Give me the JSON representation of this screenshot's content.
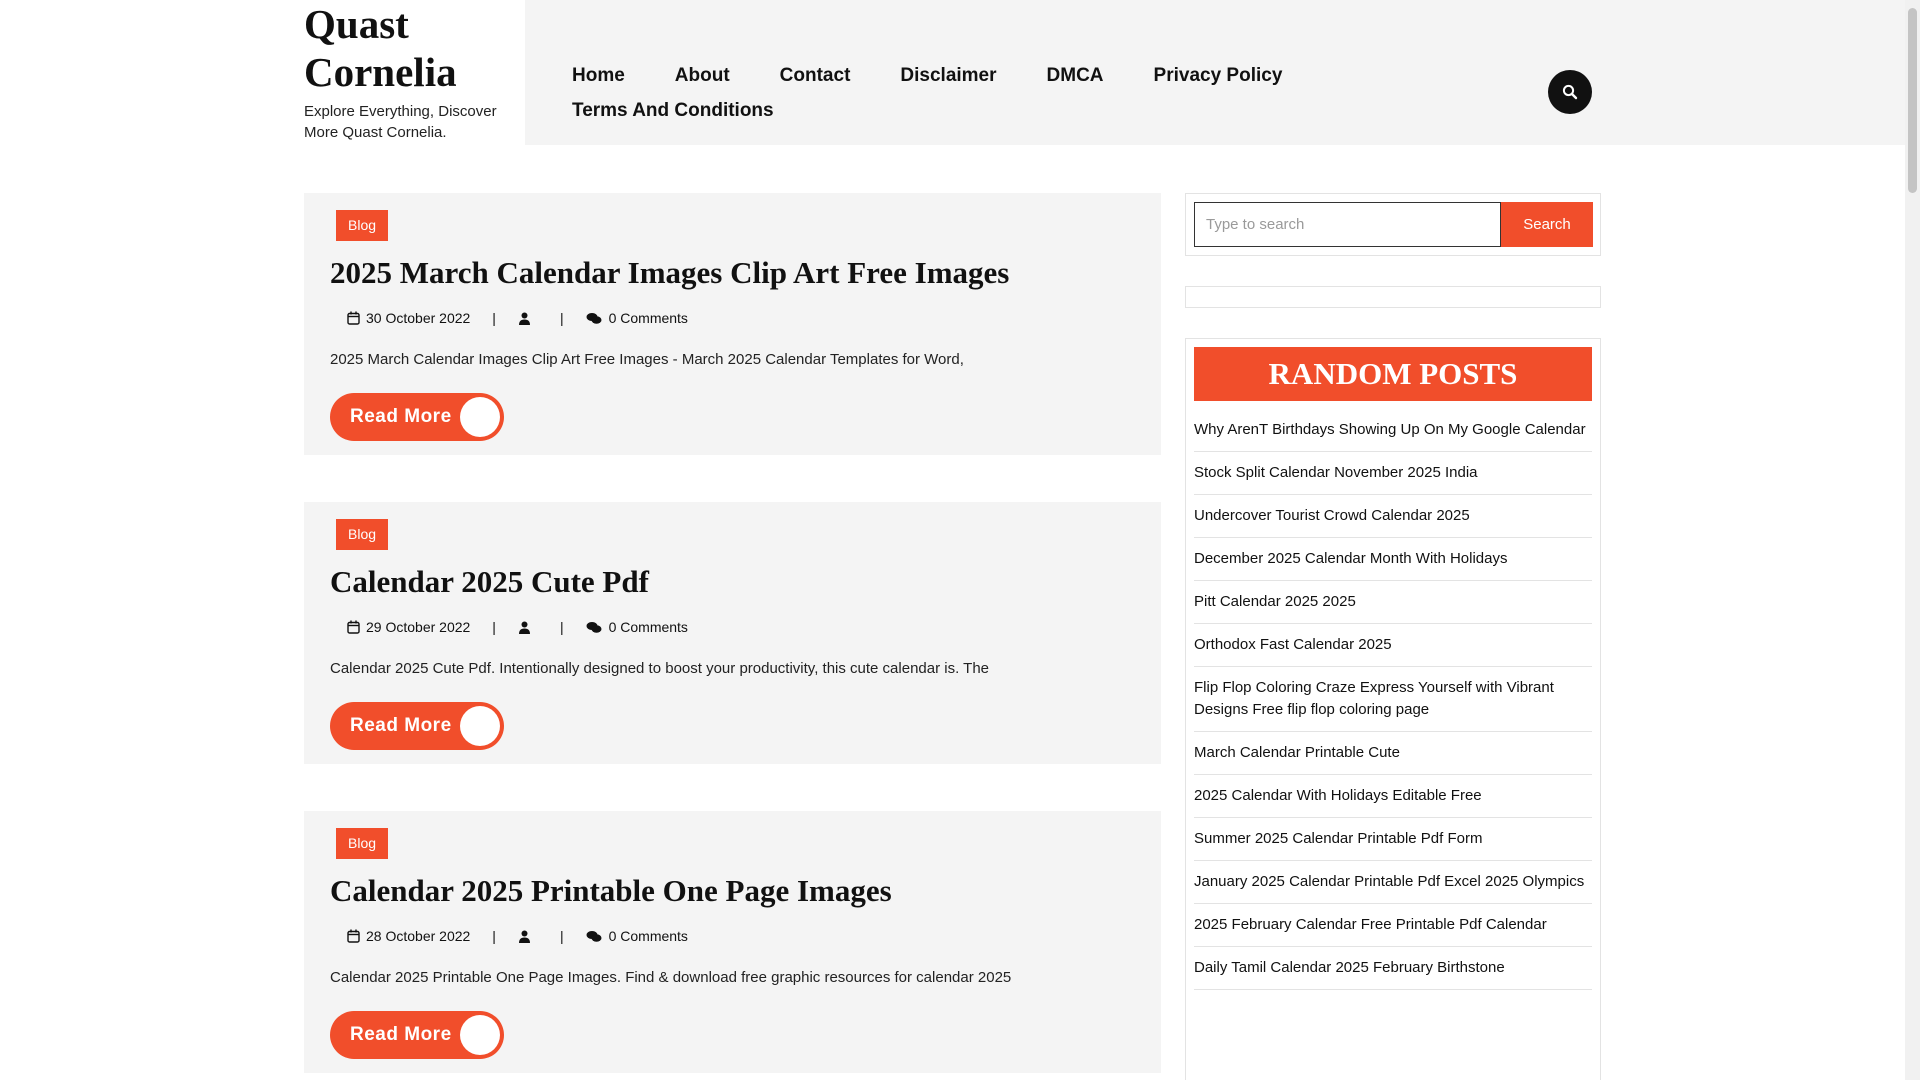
{
  "site": {
    "title": "Quast Cornelia",
    "tagline": "Explore Everything, Discover More Quast Cornelia."
  },
  "nav": {
    "items": [
      "Home",
      "About",
      "Contact",
      "Disclaimer",
      "DMCA",
      "Privacy Policy",
      "Terms And Conditions"
    ]
  },
  "header_search_icon": "search-icon",
  "posts": [
    {
      "category": "Blog",
      "title": "2025 March Calendar Images Clip Art Free Images",
      "date": "30 October 2022",
      "comments": "0 Comments",
      "excerpt": "2025 March Calendar Images Clip Art Free Images - March 2025 Calendar Templates for Word,",
      "read_more": "Read More"
    },
    {
      "category": "Blog",
      "title": "Calendar 2025 Cute Pdf",
      "date": "29 October 2022",
      "comments": "0 Comments",
      "excerpt": "Calendar 2025 Cute Pdf. Intentionally designed to boost your productivity, this cute calendar is. The",
      "read_more": "Read More"
    },
    {
      "category": "Blog",
      "title": "Calendar 2025 Printable One Page Images",
      "date": "28 October 2022",
      "comments": "0 Comments",
      "excerpt": "Calendar 2025 Printable One Page Images. Find & download free graphic resources for calendar 2025",
      "read_more": "Read More"
    }
  ],
  "sidebar": {
    "search": {
      "placeholder": "Type to search",
      "button": "Search"
    },
    "random_posts": {
      "heading": "RANDOM POSTS",
      "items": [
        "Why ArenT Birthdays Showing Up On My Google Calendar",
        "Stock Split Calendar November 2025 India",
        "Undercover Tourist Crowd Calendar 2025",
        "December 2025 Calendar Month With Holidays",
        "Pitt Calendar 2025 2025",
        "Orthodox Fast Calendar 2025",
        "Flip Flop Coloring Craze Express Yourself with Vibrant Designs Free flip flop coloring page",
        "March Calendar Printable Cute",
        "2025 Calendar With Holidays Editable Free",
        "Summer 2025 Calendar Printable Pdf Form",
        "January 2025 Calendar Printable Pdf Excel 2025 Olympics",
        "2025 February Calendar Free Printable Pdf Calendar",
        "Daily Tamil Calendar 2025 February Birthstone"
      ]
    }
  },
  "colors": {
    "accent": "#f14e2b",
    "nav_background": "#f4f4f4",
    "post_background": "#f4f4f4"
  }
}
